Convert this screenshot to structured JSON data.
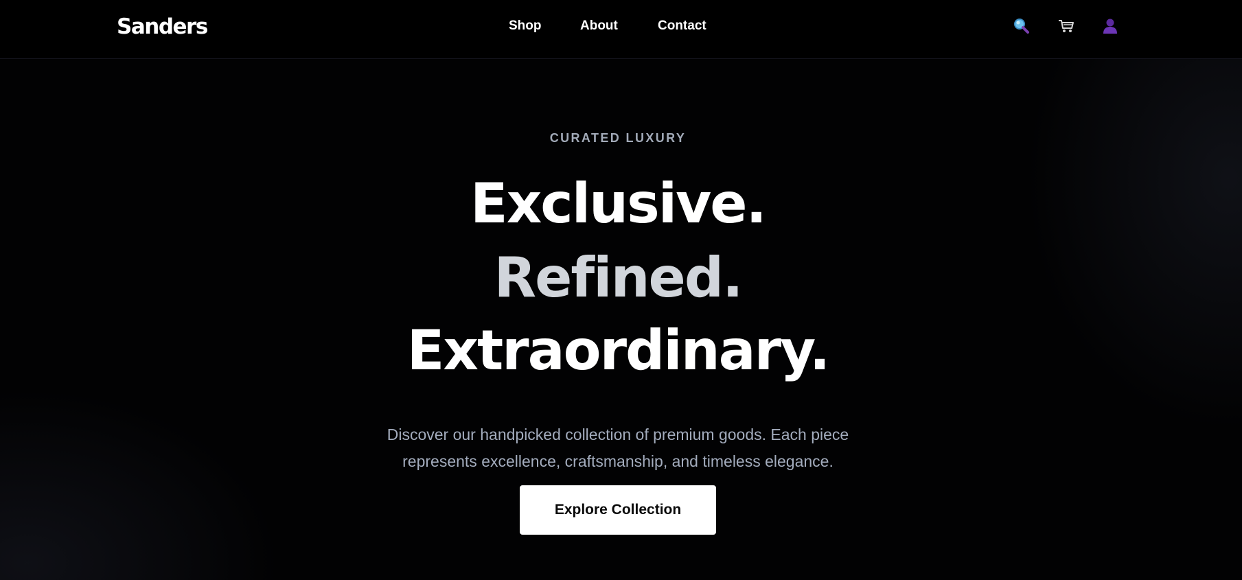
{
  "header": {
    "logo": "Sanders",
    "nav": [
      {
        "label": "Shop"
      },
      {
        "label": "About"
      },
      {
        "label": "Contact"
      }
    ],
    "icons": [
      "search-icon",
      "cart-icon",
      "user-icon"
    ]
  },
  "hero": {
    "eyebrow": "CURATED LUXURY",
    "headline": [
      "Exclusive.",
      "Refined.",
      "Extraordinary."
    ],
    "subtext": [
      "Discover our handpicked collection of premium goods. Each piece",
      "represents excellence, craftsmanship, and timeless elegance."
    ],
    "cta_label": "Explore Collection"
  },
  "colors": {
    "background": "#020203",
    "text_primary": "#ffffff",
    "headline_accent": "#d1d5db",
    "muted_text": "#a3acbd",
    "search_icon": "#4aa3df",
    "user_icon": "#5b2a9e"
  }
}
